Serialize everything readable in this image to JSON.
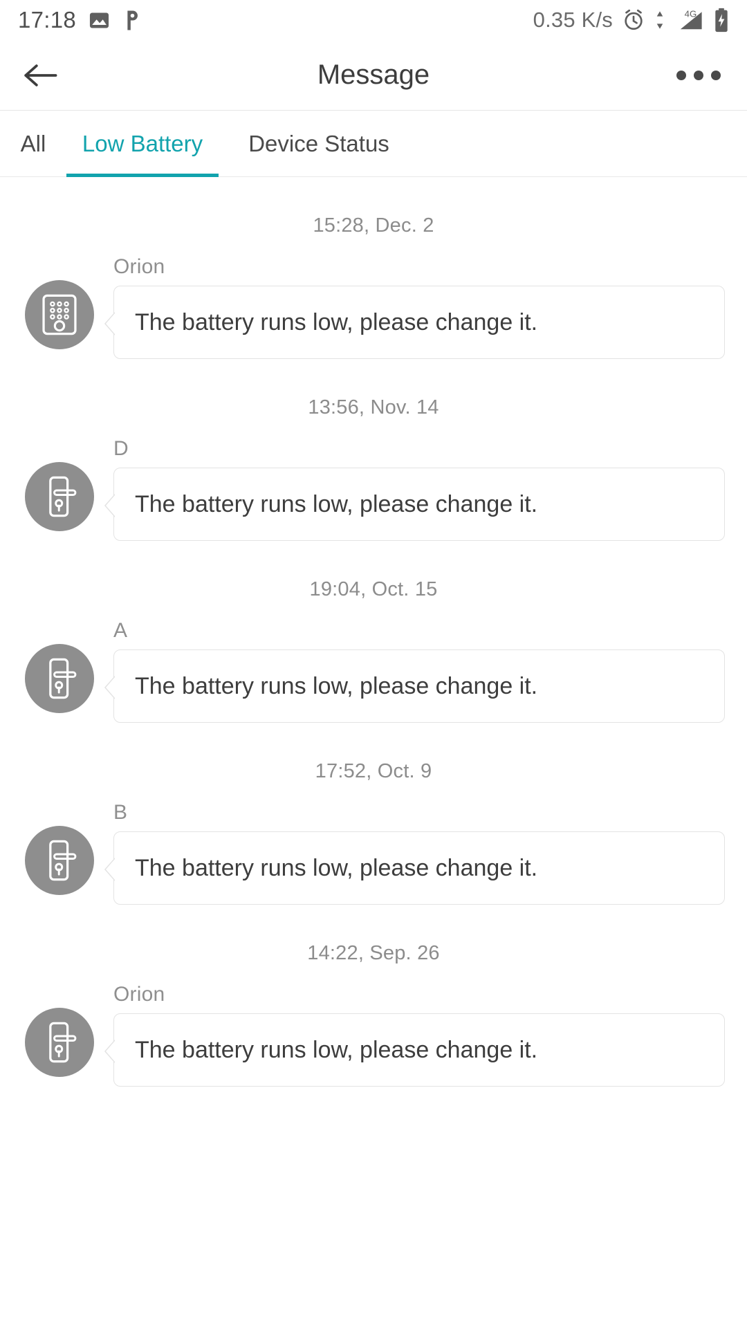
{
  "statusbar": {
    "time": "17:18",
    "network_speed": "0.35 K/s",
    "network_type": "4G",
    "icons": [
      "photo-icon",
      "p-app-icon",
      "alarm-icon",
      "data-transfer-icon",
      "signal-icon",
      "battery-charging-icon"
    ]
  },
  "header": {
    "title": "Message",
    "back_label": "",
    "more_label": ""
  },
  "tabs": {
    "active_index": 1,
    "items": [
      {
        "label": "All"
      },
      {
        "label": "Low Battery"
      },
      {
        "label": "Device Status"
      }
    ]
  },
  "colors": {
    "accent": "#12a3ad",
    "avatar_bg": "#8e8e8e",
    "text_primary": "#3d3d3d",
    "text_secondary": "#8c8c8c",
    "border": "#e3e3e3"
  },
  "messages": [
    {
      "timestamp": "15:28, Dec. 2",
      "sender": "Orion",
      "text": "The battery runs low, please change it.",
      "icon": "keypad-lock-icon"
    },
    {
      "timestamp": "13:56, Nov. 14",
      "sender": "D",
      "text": "The battery runs low, please change it.",
      "icon": "door-handle-lock-icon"
    },
    {
      "timestamp": "19:04, Oct. 15",
      "sender": "A",
      "text": "The battery runs low, please change it.",
      "icon": "door-handle-lock-icon"
    },
    {
      "timestamp": "17:52, Oct. 9",
      "sender": "B",
      "text": "The battery runs low, please change it.",
      "icon": "door-handle-lock-icon"
    },
    {
      "timestamp": "14:22, Sep. 26",
      "sender": "Orion",
      "text": "The battery runs low, please change it.",
      "icon": "door-handle-lock-icon"
    }
  ]
}
